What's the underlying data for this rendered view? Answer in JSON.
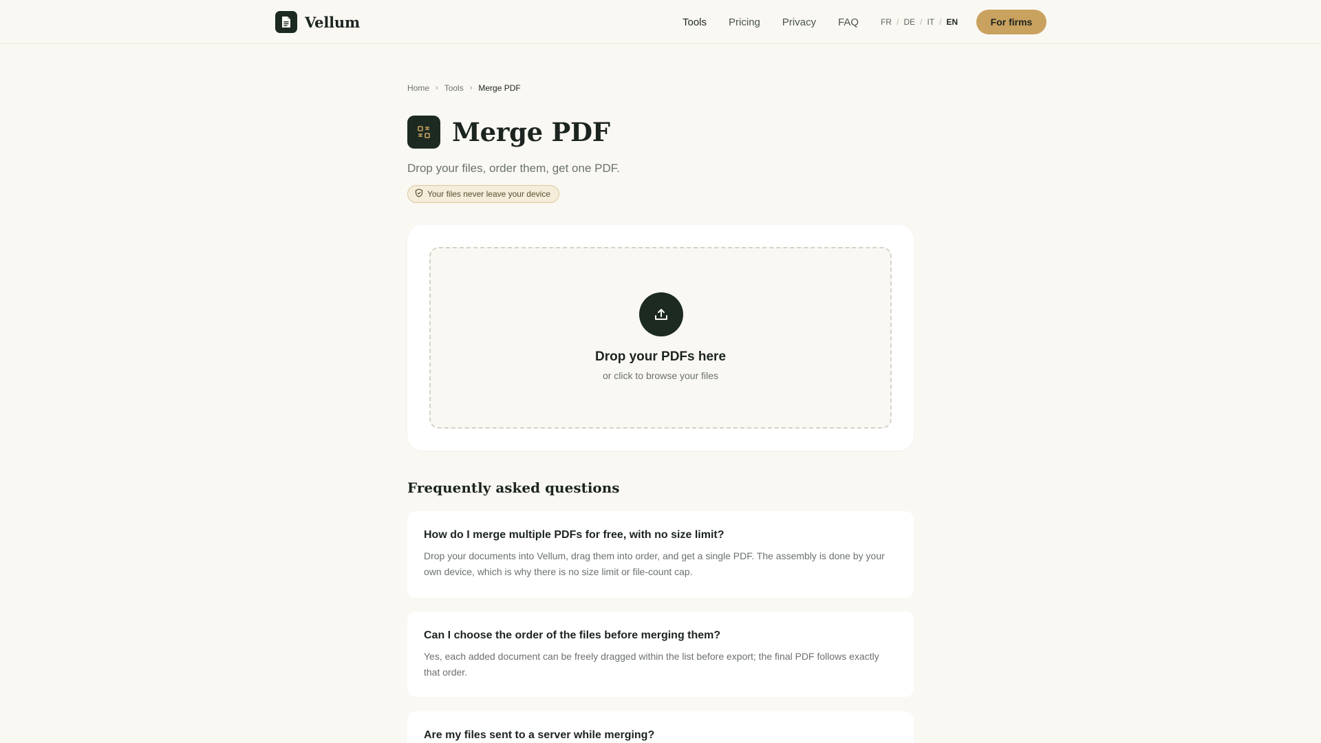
{
  "brand": {
    "name": "Vellum",
    "icon": "document-icon"
  },
  "nav": {
    "links": [
      "Tools",
      "Pricing",
      "Privacy",
      "FAQ"
    ],
    "active": "Tools",
    "languages": [
      "FR",
      "DE",
      "IT",
      "EN"
    ],
    "active_language": "EN",
    "cta": "For firms"
  },
  "breadcrumb": [
    "Home",
    "Tools",
    "Merge PDF"
  ],
  "page": {
    "title": "Merge PDF",
    "title_icon": "merge-icon",
    "subtitle": "Drop your files, order them, get one PDF.",
    "badge": "Your files never leave your device",
    "badge_icon": "shield-check-icon"
  },
  "dropzone": {
    "icon": "upload-icon",
    "title": "Drop your PDFs here",
    "subtitle": "or click to browse your files"
  },
  "faq": {
    "heading": "Frequently asked questions",
    "items": [
      {
        "question": "How do I merge multiple PDFs for free, with no size limit?",
        "answer": "Drop your documents into Vellum, drag them into order, and get a single PDF. The assembly is done by your own device, which is why there is no size limit or file-count cap."
      },
      {
        "question": "Can I choose the order of the files before merging them?",
        "answer": "Yes, each added document can be freely dragged within the list before export; the final PDF follows exactly that order."
      },
      {
        "question": "Are my files sent to a server while merging?",
        "answer": ""
      }
    ]
  },
  "colors": {
    "background": "#faf8f3",
    "primary_dark": "#1c2a22",
    "accent_gold": "#c9a25f",
    "card": "#ffffff"
  }
}
